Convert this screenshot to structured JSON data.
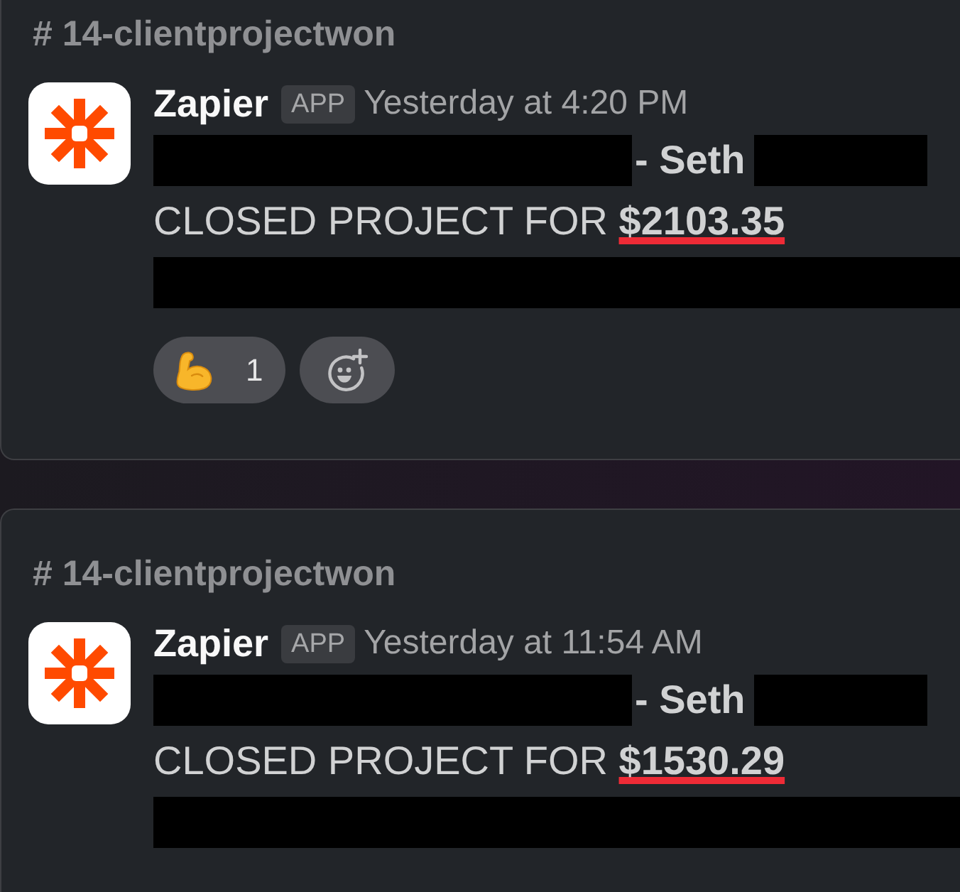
{
  "cards": [
    {
      "channel": "# 14-clientprojectwon",
      "sender": {
        "name": "Zapier",
        "badge": "APP"
      },
      "time": "Yesterday at 4:20 PM",
      "lines": [
        {
          "segments": [
            {
              "kind": "redacted"
            },
            {
              "kind": "text",
              "text": "- Seth",
              "bold": true,
              "annotated": false
            },
            {
              "kind": "redacted"
            }
          ]
        },
        {
          "segments": [
            {
              "kind": "text",
              "text": "CLOSED PROJECT FOR **$2103.35**",
              "bold": false,
              "annotated": true
            }
          ]
        },
        {
          "segments": [
            {
              "kind": "redacted"
            }
          ]
        }
      ],
      "reactions": [
        {
          "kind": "emoji",
          "count": "1"
        },
        {
          "kind": "add"
        }
      ]
    },
    {
      "channel": "# 14-clientprojectwon",
      "sender": {
        "name": "Zapier",
        "badge": "APP"
      },
      "time": "Yesterday at 11:54 AM",
      "lines": [
        {
          "segments": [
            {
              "kind": "redacted"
            },
            {
              "kind": "text",
              "text": "- Seth",
              "bold": true,
              "annotated": false
            },
            {
              "kind": "redacted"
            }
          ]
        },
        {
          "segments": [
            {
              "kind": "text",
              "text": "CLOSED PROJECT FOR **$1530.29**",
              "bold": false,
              "annotated": true
            }
          ]
        },
        {
          "segments": [
            {
              "kind": "redacted"
            }
          ]
        }
      ]
    }
  ]
}
